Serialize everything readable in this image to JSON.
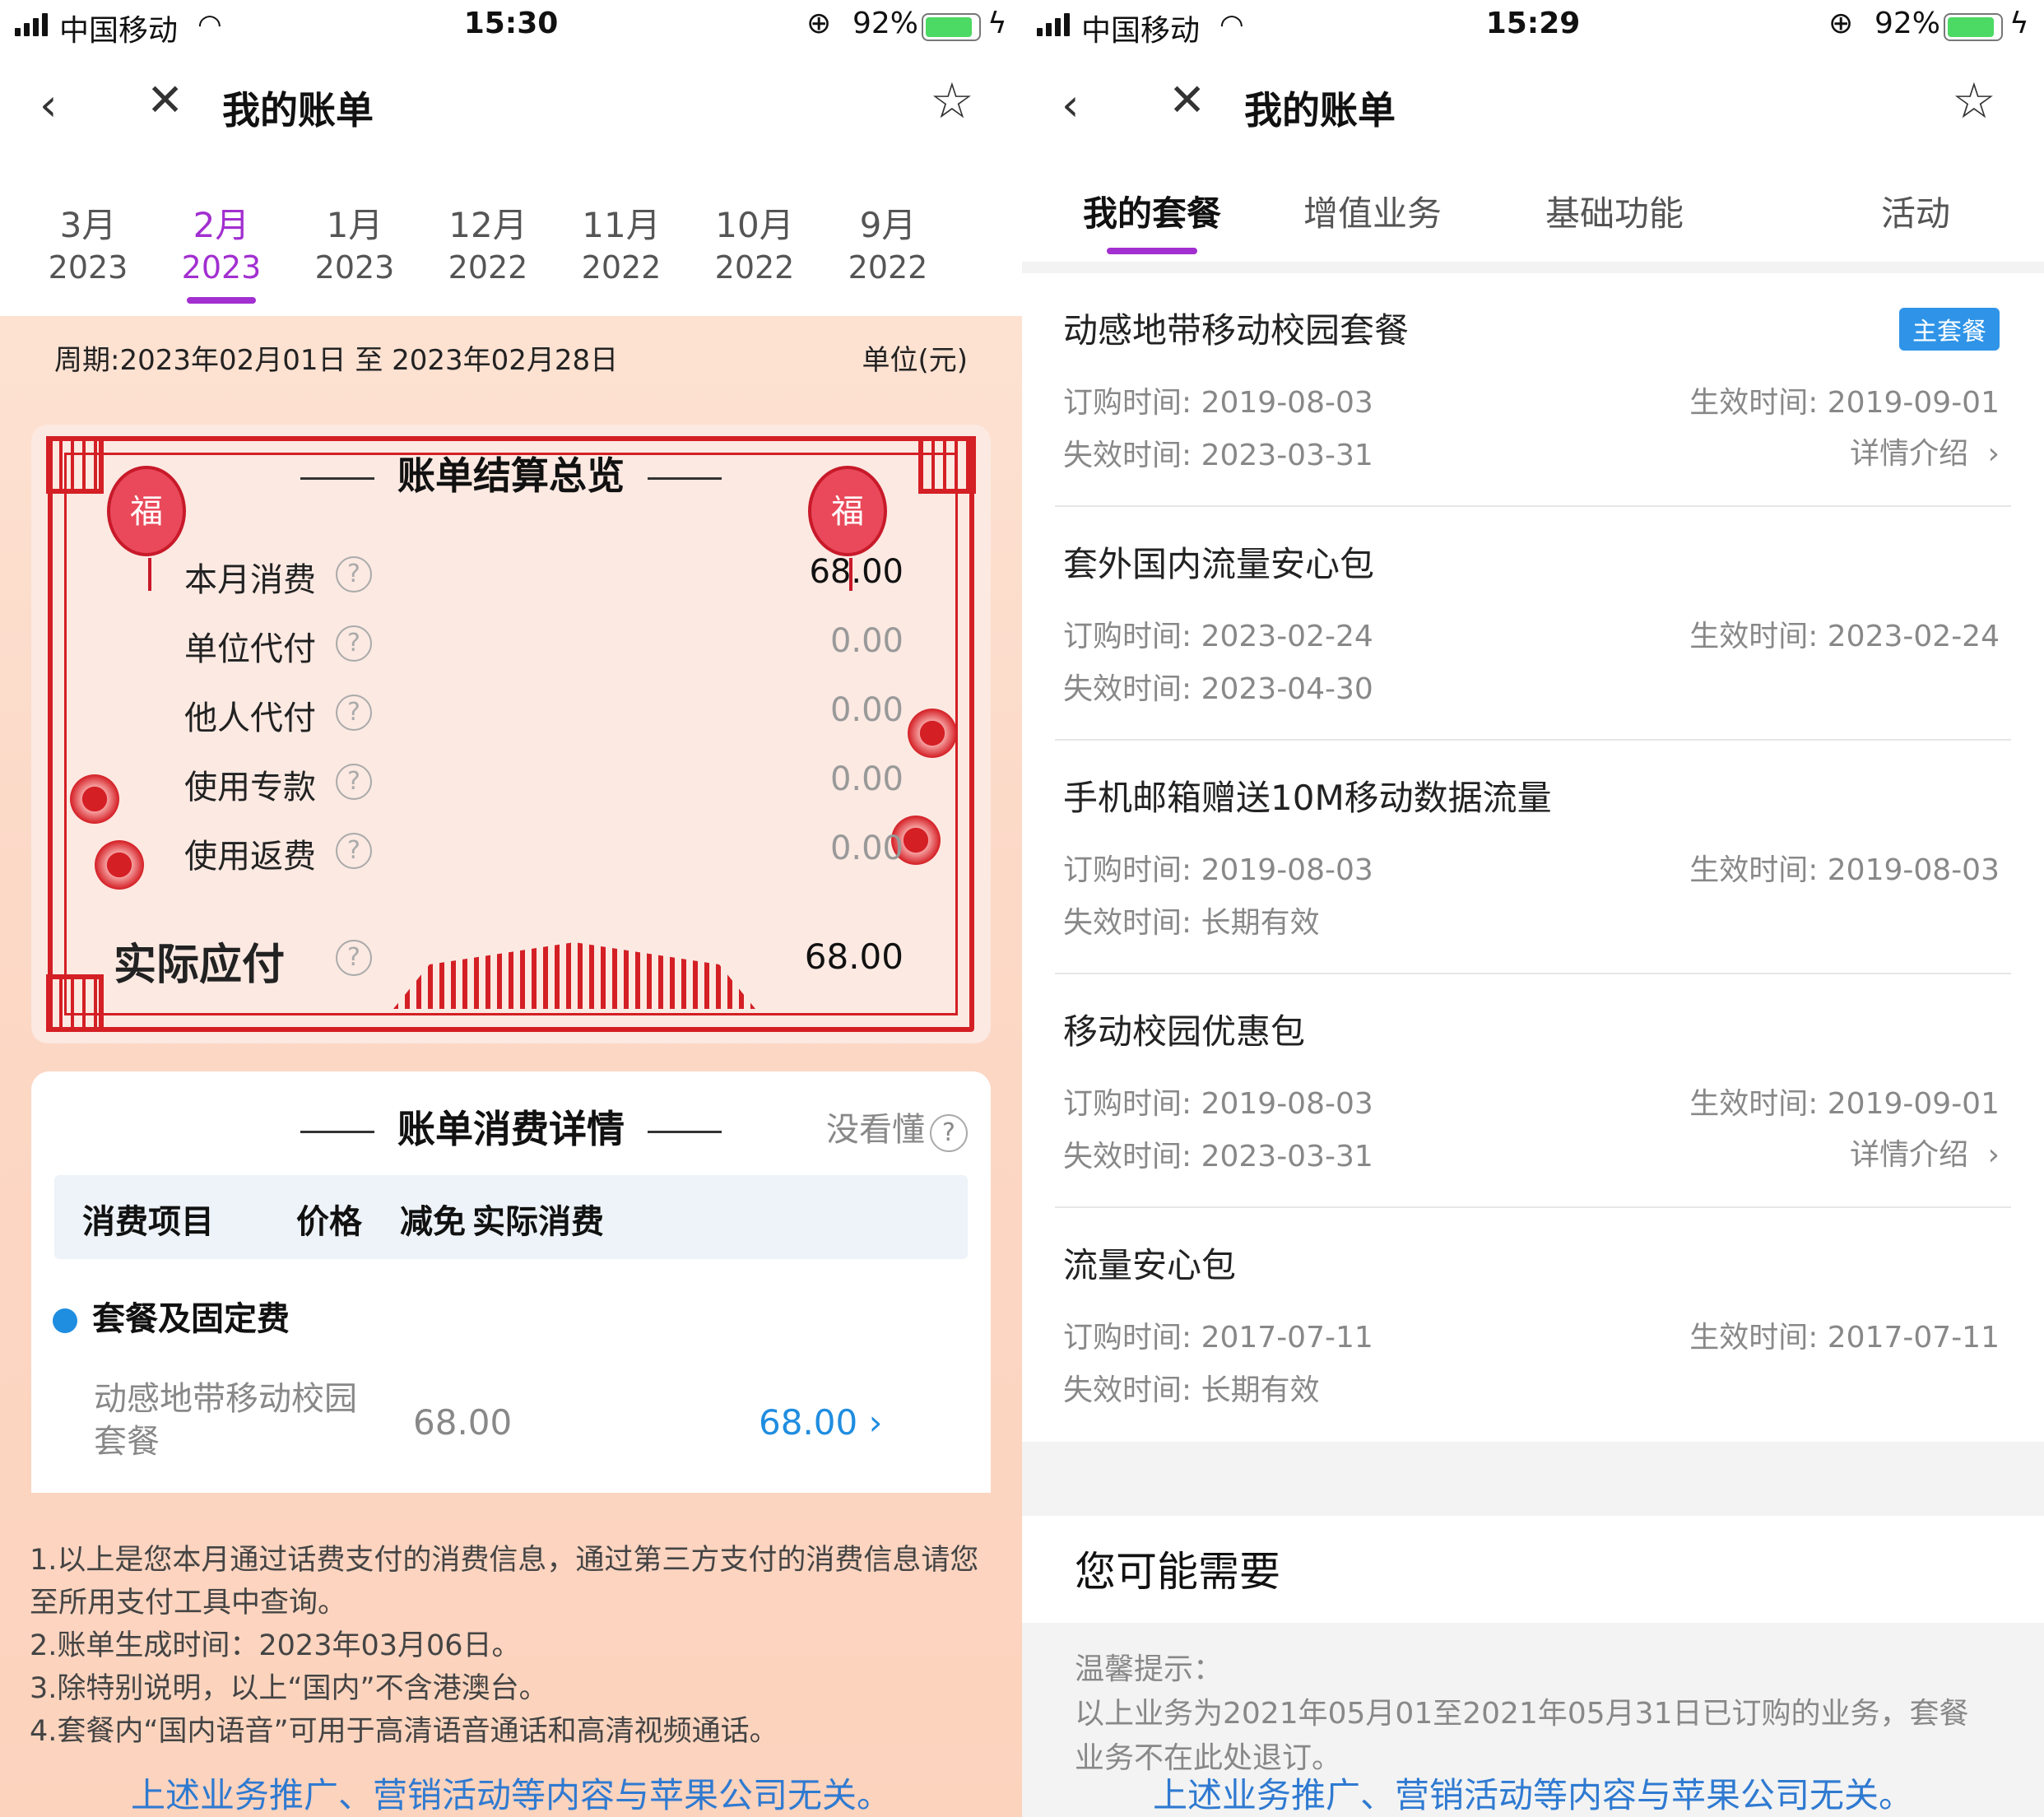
{
  "left": {
    "status": {
      "carrier": "中国移动",
      "time": "15:30",
      "battery": "92%"
    },
    "title": "我的账单",
    "months": [
      {
        "m": "3月",
        "y": "2023"
      },
      {
        "m": "2月",
        "y": "2023"
      },
      {
        "m": "1月",
        "y": "2023"
      },
      {
        "m": "12月",
        "y": "2022"
      },
      {
        "m": "11月",
        "y": "2022"
      },
      {
        "m": "10月",
        "y": "2022"
      },
      {
        "m": "9月",
        "y": "2022"
      }
    ],
    "period": "周期:2023年02月01日 至 2023年02月28日",
    "unit": "单位(元)",
    "summary": {
      "title": "账单结算总览",
      "fu": "福",
      "rows": [
        {
          "label": "本月消费",
          "value": "68.00"
        },
        {
          "label": "单位代付",
          "value": "0.00"
        },
        {
          "label": "他人代付",
          "value": "0.00"
        },
        {
          "label": "使用专款",
          "value": "0.00"
        },
        {
          "label": "使用返费",
          "value": "0.00"
        }
      ],
      "final": {
        "label": "实际应付",
        "value": "68.00"
      }
    },
    "details": {
      "title": "账单消费详情",
      "help": "没看懂",
      "headers": [
        "消费项目",
        "价格",
        "减免",
        "实际消费"
      ],
      "section": "套餐及固定费",
      "item": {
        "name": "动感地带移动校园套餐",
        "price": "68.00",
        "actual": "68.00"
      }
    },
    "notes": [
      "1.以上是您本月通过话费支付的消费信息，通过第三方支付的消费信息请您至所用支付工具中查询。",
      "2.账单生成时间：2023年03月06日。",
      "3.除特别说明，以上“国内”不含港澳台。",
      "4.套餐内“国内语音”可用于高清语音通话和高清视频通话。"
    ],
    "disclaimer": "上述业务推广、营销活动等内容与苹果公司无关。"
  },
  "right": {
    "status": {
      "carrier": "中国移动",
      "time": "15:29",
      "battery": "92%"
    },
    "title": "我的账单",
    "tabs": [
      "我的套餐",
      "增值业务",
      "基础功能",
      "活动"
    ],
    "packages": [
      {
        "name": "动感地带移动校园套餐",
        "badge": "主套餐",
        "order": "订购时间: 2019-08-03",
        "effective": "生效时间: 2019-09-01",
        "expire": "失效时间: 2023-03-31",
        "detail": "详情介绍"
      },
      {
        "name": "套外国内流量安心包",
        "badge": "",
        "order": "订购时间: 2023-02-24",
        "effective": "生效时间: 2023-02-24",
        "expire": "失效时间: 2023-04-30",
        "detail": ""
      },
      {
        "name": "手机邮箱赠送10M移动数据流量",
        "badge": "",
        "order": "订购时间: 2019-08-03",
        "effective": "生效时间: 2019-08-03",
        "expire": "失效时间: 长期有效",
        "detail": ""
      },
      {
        "name": "移动校园优惠包",
        "badge": "",
        "order": "订购时间: 2019-08-03",
        "effective": "生效时间: 2019-09-01",
        "expire": "失效时间: 2023-03-31",
        "detail": "详情介绍"
      },
      {
        "name": "流量安心包",
        "badge": "",
        "order": "订购时间: 2017-07-11",
        "effective": "生效时间: 2017-07-11",
        "expire": "失效时间: 长期有效",
        "detail": ""
      }
    ],
    "need_title": "您可能需要",
    "tips_title": "温馨提示：",
    "tips_text": "以上业务为2021年05月01至2021年05月31日已订购的业务，套餐业务不在此处退订。",
    "disclaimer": "上述业务推广、营销活动等内容与苹果公司无关。"
  }
}
